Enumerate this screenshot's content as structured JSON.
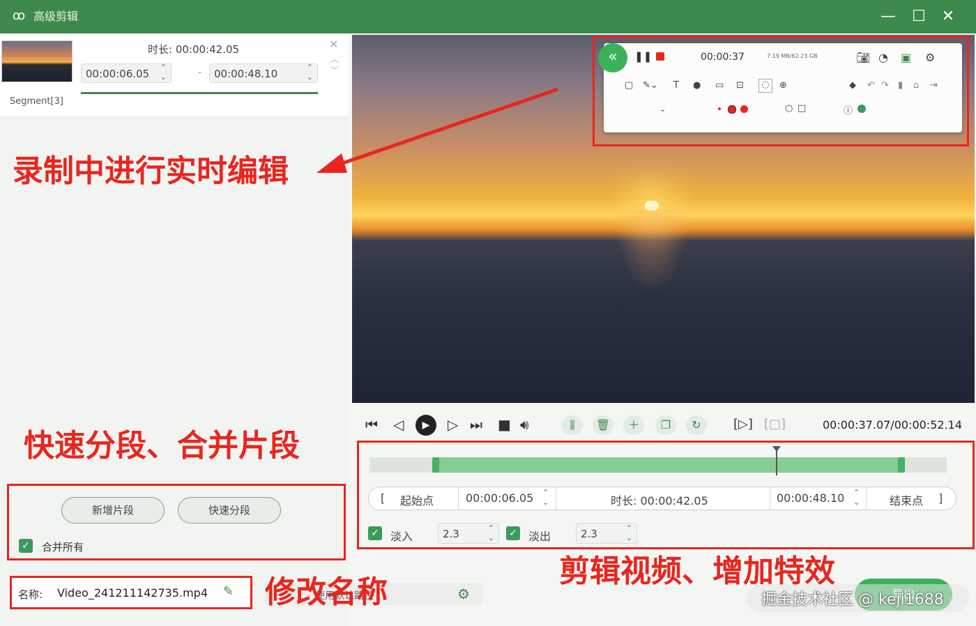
{
  "window": {
    "title": "高级剪辑",
    "logo_icon": "rabbit-logo-icon",
    "minimize": "—",
    "maximize": "☐",
    "close": "✕"
  },
  "segment": {
    "label": "Segment[3]",
    "duration": "时长: 00:00:42.05",
    "start": "00:00:06.05",
    "end": "00:00:48.10",
    "dash": "-"
  },
  "annotations": {
    "realtime_edit": "录制中进行实时编辑",
    "split_merge": "快速分段、合并片段",
    "rename": "修改名称",
    "edit_effects": "剪辑视频、增加特效"
  },
  "segment_actions": {
    "add_segment": "新增片段",
    "quick_split": "快速分段",
    "merge_all": "合并所有"
  },
  "filename": {
    "label": "名称:",
    "value": "Video_241211142735.mp4",
    "output_placeholder": "使用默认路径"
  },
  "recorder": {
    "time": "00:00:37",
    "size_info": "7.19 MB/62.23 GB"
  },
  "player": {
    "time_readout": "00:00:37.07/00:00:52.14"
  },
  "trim": {
    "start_bracket": "[",
    "start_label": "起始点",
    "start_value": "00:00:06.05",
    "duration": "时长: 00:00:42.05",
    "end_value": "00:00:48.10",
    "end_label": "结束点",
    "end_bracket": "]"
  },
  "effects": {
    "fade_in_label": "淡入",
    "fade_in_value": "2.3",
    "fade_out_label": "淡出",
    "fade_out_value": "2.3"
  },
  "export_button": "导出",
  "watermark": "掘金技术社区 @ keji1688"
}
